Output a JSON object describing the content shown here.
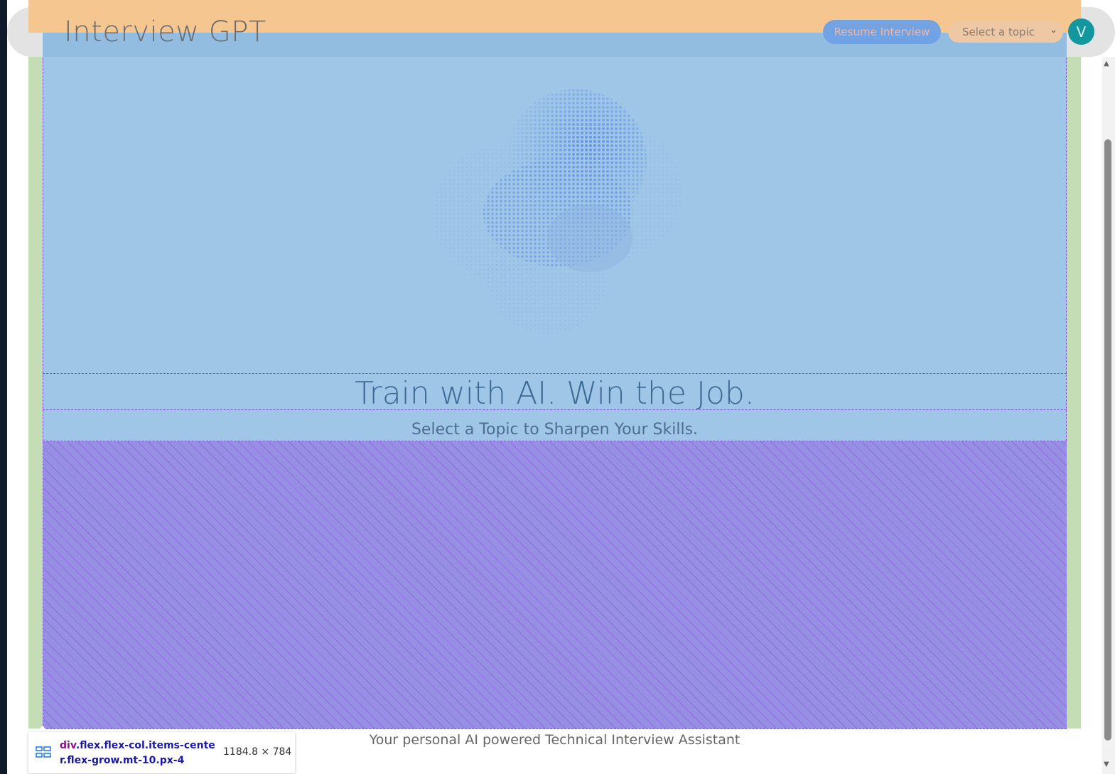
{
  "header": {
    "title": "Interview GPT",
    "resume_label": "Resume Interview",
    "topic_select": {
      "selected": "Select a topic"
    },
    "avatar_initial": "V"
  },
  "hero": {
    "title": "Train with AI. Win the Job.",
    "subtitle": "Select a Topic to Sharpen Your Skills."
  },
  "footer": {
    "text": "Your personal AI powered Technical Interview Assistant"
  },
  "devtools_tooltip": {
    "tag": "div",
    "classes_line1": ".flex.flex-col.items-cente",
    "classes_line2": "r.flex-grow.mt-10.px-4",
    "size": "1184.8 × 784"
  },
  "colors": {
    "accent_blue": "#6fa2e6",
    "avatar_teal": "#13979e",
    "overlay_content": "#9fc5e7",
    "overlay_margin": "#f5c690",
    "overlay_padding": "#c5ddb4"
  }
}
